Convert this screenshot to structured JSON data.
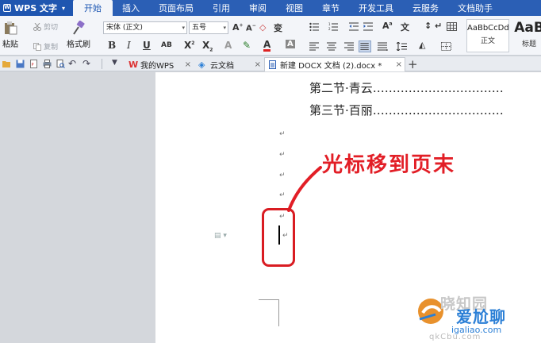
{
  "app": {
    "name": "WPS 文字"
  },
  "menu": [
    {
      "label": "开始",
      "active": true
    },
    {
      "label": "插入"
    },
    {
      "label": "页面布局"
    },
    {
      "label": "引用"
    },
    {
      "label": "审阅"
    },
    {
      "label": "视图"
    },
    {
      "label": "章节"
    },
    {
      "label": "开发工具"
    },
    {
      "label": "云服务"
    },
    {
      "label": "文档助手"
    }
  ],
  "ribbon": {
    "paste": "粘贴",
    "cut": "剪切",
    "copy": "复制",
    "format_painter": "格式刷",
    "font_name": "宋体 (正文)",
    "font_size": "五号",
    "styles": [
      {
        "sample": "AaBbCcDd",
        "name": "正文"
      },
      {
        "sample": "AaB",
        "name": "标题"
      }
    ]
  },
  "tabs": [
    {
      "label": "我的WPS"
    },
    {
      "label": "云文档"
    },
    {
      "label": "新建 DOCX 文档 (2).docx *",
      "active": true
    }
  ],
  "document": {
    "lines": [
      "第二节·青云……………………………",
      "第三节·百丽……………………………"
    ],
    "para_mark": "↵",
    "annotation": "光标移到页末"
  },
  "watermark": {
    "text1": "晓知园",
    "text2": "爱尬聊",
    "url": "igaliao.com",
    "text3": "qkCbu.com"
  },
  "colors": {
    "menu_bg": "#2b5fb5",
    "accent_red": "#e21e26",
    "page": "#ffffff"
  }
}
